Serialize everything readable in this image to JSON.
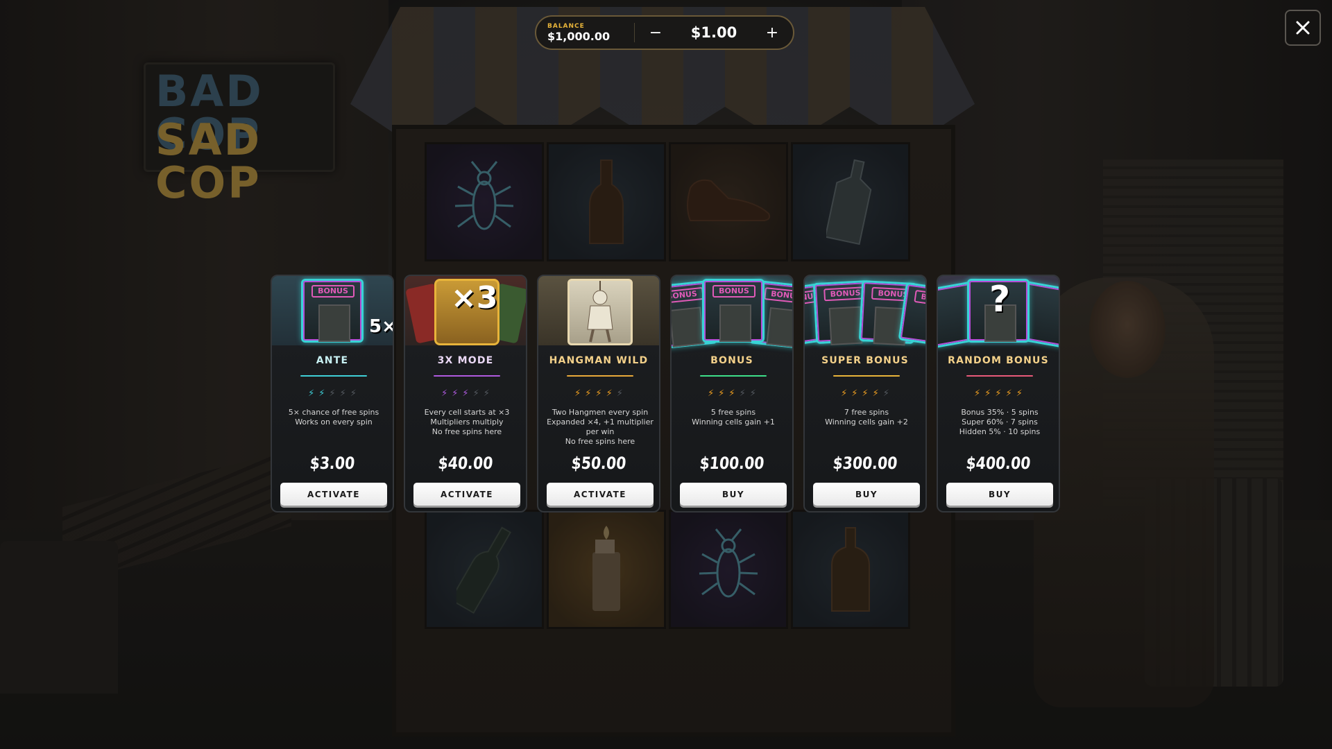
{
  "balance": {
    "label": "BALANCE",
    "value": "$1,000.00"
  },
  "bet": {
    "minus": "−",
    "value": "$1.00",
    "plus": "+"
  },
  "sign": {
    "line1": "BAD COP",
    "line2": "SAD COP"
  },
  "colors": {
    "ante": "#3fd0d8",
    "mode3x": "#b05ae0",
    "hangman": "#e8a93a",
    "bonus": "#3ee08a",
    "super": "#e8b43a",
    "random": "#e85a7a",
    "bolt_gold": "#f0a020",
    "bolt_off": "#555a60",
    "gold_accent": "#e7b43a"
  },
  "cards": [
    {
      "title": "ANTE",
      "art_badge": "5×",
      "art_tag": "BONUS",
      "bolts": [
        "⚡",
        "⚡",
        "⚡",
        "⚡",
        "⚡"
      ],
      "bolts_on": 2,
      "desc": [
        "5× chance of free spins",
        "Works on every spin"
      ],
      "price": "$3.00",
      "button": "ACTIVATE"
    },
    {
      "title": "3X MODE",
      "art_badge": "×3",
      "bolts": [
        "⚡",
        "⚡",
        "⚡",
        "⚡",
        "⚡"
      ],
      "bolts_on": 3,
      "desc": [
        "Every cell starts at ×3",
        "Multipliers multiply",
        "No free spins here"
      ],
      "price": "$40.00",
      "button": "ACTIVATE"
    },
    {
      "title": "HANGMAN WILD",
      "bolts": [
        "⚡",
        "⚡",
        "⚡",
        "⚡",
        "⚡"
      ],
      "bolts_on": 4,
      "desc": [
        "Two Hangmen every spin",
        "Expanded ×4, +1 multiplier",
        "per win",
        "No free spins here"
      ],
      "price": "$50.00",
      "button": "ACTIVATE"
    },
    {
      "title": "BONUS",
      "art_tag": "BONUS",
      "bolts": [
        "⚡",
        "⚡",
        "⚡",
        "⚡",
        "⚡"
      ],
      "bolts_on": 3,
      "desc": [
        "5 free spins",
        "Winning cells gain +1"
      ],
      "price": "$100.00",
      "button": "BUY"
    },
    {
      "title": "SUPER BONUS",
      "art_tag": "BONUS",
      "bolts": [
        "⚡",
        "⚡",
        "⚡",
        "⚡",
        "⚡"
      ],
      "bolts_on": 4,
      "desc": [
        "7 free spins",
        "Winning cells gain +2"
      ],
      "price": "$300.00",
      "button": "BUY"
    },
    {
      "title": "RANDOM BONUS",
      "art_badge": "?",
      "bolts": [
        "⚡",
        "⚡",
        "⚡",
        "⚡",
        "⚡"
      ],
      "bolts_on": 5,
      "desc": [
        "Bonus 35% · 5 spins",
        "Super 60% · 7 spins",
        "Hidden 5% · 10 spins"
      ],
      "price": "$400.00",
      "button": "BUY"
    }
  ],
  "grid_symbols": {
    "top": [
      "bug-icon",
      "bottle-icon",
      "shoe-icon",
      "flask-icon"
    ],
    "bottom": [
      "wine-bottle-icon",
      "lighter-icon",
      "bug-icon",
      "whiskey-bottle-icon"
    ]
  }
}
